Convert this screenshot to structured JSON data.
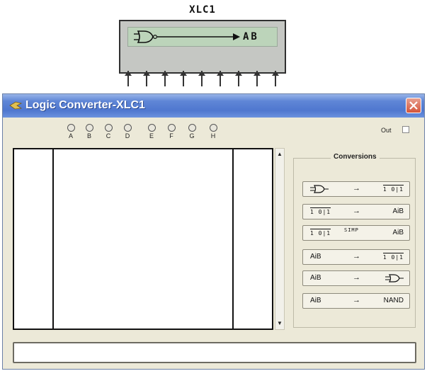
{
  "symbol": {
    "title": "XLC1",
    "output_label": "AB",
    "pin_count": 9
  },
  "window": {
    "title": "Logic Converter-XLC1",
    "close_glyph": "✕"
  },
  "probes": [
    "A",
    "B",
    "C",
    "D",
    "E",
    "F",
    "G",
    "H"
  ],
  "out": {
    "label": "Out",
    "checked": false
  },
  "conversions": {
    "title": "Conversions",
    "buttons": [
      {
        "lhs": "gate-icon",
        "rhs": "1 0|1",
        "lhs_text": "",
        "rhs_text": "1 0|1",
        "via": ""
      },
      {
        "lhs": "1 0|1",
        "rhs": "AiB",
        "lhs_text": "1 0|1",
        "rhs_text": "AiB",
        "via": ""
      },
      {
        "lhs": "1 0|1",
        "rhs": "AiB",
        "lhs_text": "1 0|1",
        "rhs_text": "AiB",
        "via": "SIMP"
      },
      {
        "lhs": "AiB",
        "rhs": "1 0|1",
        "lhs_text": "AiB",
        "rhs_text": "1 0|1",
        "via": ""
      },
      {
        "lhs": "AiB",
        "rhs": "gate-icon",
        "lhs_text": "AiB",
        "rhs_text": "",
        "via": ""
      },
      {
        "lhs": "AiB",
        "rhs": "NAND",
        "lhs_text": "AiB",
        "rhs_text": "NAND",
        "via": ""
      }
    ],
    "arrow": "→"
  },
  "expression": {
    "value": ""
  },
  "colors": {
    "titlebar": "#4f77cf",
    "window_bg": "#ece9d8",
    "symbol_inner": "#bcd4ba",
    "close_button": "#d5553a"
  },
  "scrollbar": {
    "up": "▲",
    "down": "▼"
  }
}
